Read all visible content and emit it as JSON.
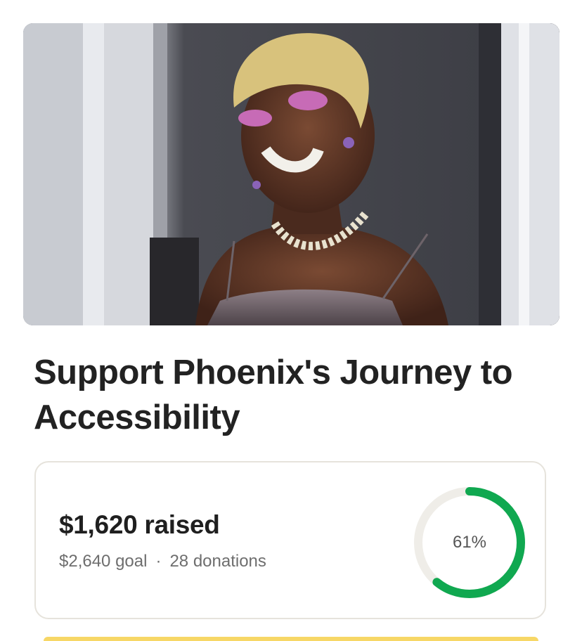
{
  "campaign": {
    "title": "Support Phoenix's Journey to Accessibility",
    "raised_text": "$1,620 raised",
    "goal_text": "$2,640 goal",
    "separator": "·",
    "donations_text": "28 donations",
    "progress_label": "61%",
    "progress_fraction": 0.61
  },
  "colors": {
    "progress": "#10a850",
    "track": "#efede8",
    "accent_strip": "#f7d766"
  },
  "icons": {
    "hero": "campaign-photo"
  }
}
